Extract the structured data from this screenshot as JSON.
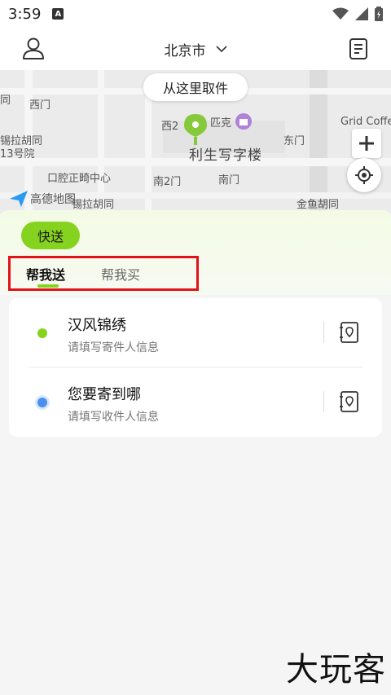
{
  "status": {
    "time": "3:59",
    "notification_glyph": "A"
  },
  "header": {
    "city": "北京市"
  },
  "map": {
    "pickup_bubble": "从这里取件",
    "labels": {
      "tong": "同",
      "ximen": "西门",
      "xiaxi_hutong": "锡拉胡同",
      "no13": "13号院",
      "west2": "西2",
      "pike": "匹克",
      "lisheng_building": "利生写字楼",
      "dongmen": "东门",
      "grid_coffee": "Grid Coffe",
      "dental": "口腔正畸中心",
      "south2": "南2门",
      "nanmen": "南门",
      "xila_hutong": "锡拉胡同",
      "jinyu_hutong": "金鱼胡同",
      "amap": "高德地图"
    }
  },
  "service": {
    "chip": "快送",
    "tabs": [
      "帮我送",
      "帮我买"
    ]
  },
  "sender": {
    "title": "汉风锦绣",
    "subtitle": "请填写寄件人信息"
  },
  "receiver": {
    "title": "您要寄到哪",
    "subtitle": "请填写收件人信息"
  },
  "watermark": "大玩客",
  "colors": {
    "accent": "#86d31f",
    "highlight_box": "#e0131a",
    "receiver_dot": "#4a8ff0"
  }
}
